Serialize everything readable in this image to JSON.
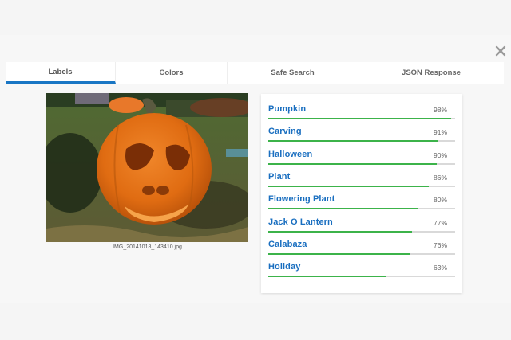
{
  "tabs": [
    {
      "label": "Labels",
      "active": true
    },
    {
      "label": "Colors",
      "active": false
    },
    {
      "label": "Safe Search",
      "active": false
    },
    {
      "label": "JSON Response",
      "active": false
    }
  ],
  "image": {
    "filename": "IMG_20141018_143410.jpg"
  },
  "labels": [
    {
      "name": "Pumpkin",
      "score": "98%",
      "value": 0.98
    },
    {
      "name": "Carving",
      "score": "91%",
      "value": 0.91
    },
    {
      "name": "Halloween",
      "score": "90%",
      "value": 0.9
    },
    {
      "name": "Plant",
      "score": "86%",
      "value": 0.86
    },
    {
      "name": "Flowering Plant",
      "score": "80%",
      "value": 0.8
    },
    {
      "name": "Jack O Lantern",
      "score": "77%",
      "value": 0.77
    },
    {
      "name": "Calabaza",
      "score": "76%",
      "value": 0.76
    },
    {
      "name": "Holiday",
      "score": "63%",
      "value": 0.63
    }
  ],
  "colors": {
    "accent": "#1976c4",
    "label_text": "#1a6fc0",
    "bar": "#3cb34a"
  },
  "icons": {
    "close": "close-icon"
  }
}
